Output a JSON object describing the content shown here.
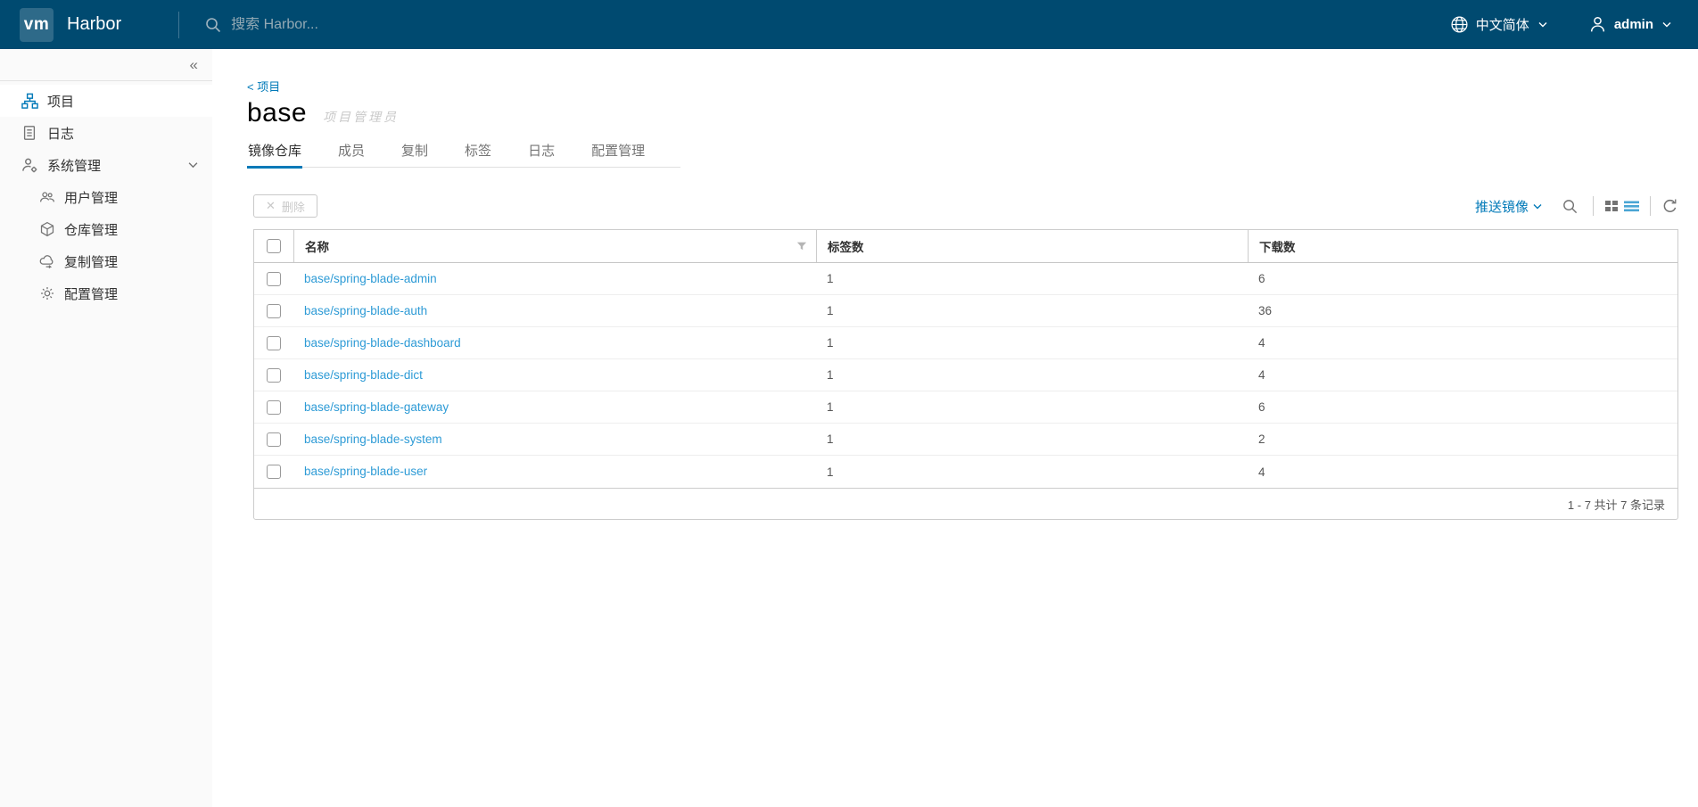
{
  "header": {
    "logo_text": "vm",
    "brand": "Harbor",
    "search_placeholder": "搜索 Harbor...",
    "language": "中文简体",
    "username": "admin"
  },
  "sidebar": {
    "items": [
      {
        "label": "项目"
      },
      {
        "label": "日志"
      },
      {
        "label": "系统管理"
      }
    ],
    "sub_items": [
      {
        "label": "用户管理"
      },
      {
        "label": "仓库管理"
      },
      {
        "label": "复制管理"
      },
      {
        "label": "配置管理"
      }
    ]
  },
  "main": {
    "breadcrumb": "< 项目",
    "title": "base",
    "role_badge": "项目管理员",
    "tabs": [
      {
        "label": "镜像仓库",
        "active": true
      },
      {
        "label": "成员",
        "active": false
      },
      {
        "label": "复制",
        "active": false
      },
      {
        "label": "标签",
        "active": false
      },
      {
        "label": "日志",
        "active": false
      },
      {
        "label": "配置管理",
        "active": false
      }
    ],
    "toolbar": {
      "delete_label": "删除",
      "push_image_label": "推送镜像"
    },
    "table": {
      "columns": {
        "name": "名称",
        "tags": "标签数",
        "pulls": "下载数"
      },
      "rows": [
        {
          "name": "base/spring-blade-admin",
          "tags": "1",
          "pulls": "6"
        },
        {
          "name": "base/spring-blade-auth",
          "tags": "1",
          "pulls": "36"
        },
        {
          "name": "base/spring-blade-dashboard",
          "tags": "1",
          "pulls": "4"
        },
        {
          "name": "base/spring-blade-dict",
          "tags": "1",
          "pulls": "4"
        },
        {
          "name": "base/spring-blade-gateway",
          "tags": "1",
          "pulls": "6"
        },
        {
          "name": "base/spring-blade-system",
          "tags": "1",
          "pulls": "2"
        },
        {
          "name": "base/spring-blade-user",
          "tags": "1",
          "pulls": "4"
        }
      ],
      "footer": "1 - 7 共计 7 条记录"
    }
  },
  "icons": {
    "collapse": "«",
    "close": "✕"
  },
  "colors": {
    "header_bg": "#004a70",
    "accent_blue": "#0079b8",
    "link_blue": "#2e9bd6",
    "sidebar_bg": "#fafafa",
    "border_gray": "#cccccc"
  }
}
